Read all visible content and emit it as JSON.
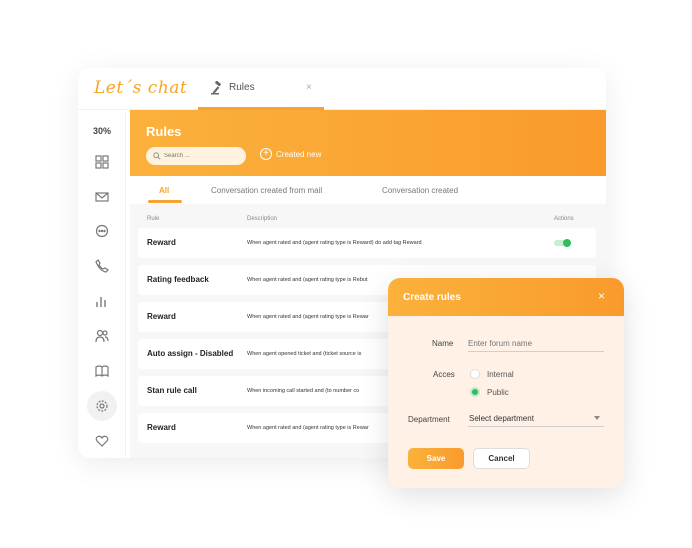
{
  "app": {
    "logo_text": "Let´s chat",
    "tab_label": "Rules",
    "tab_close": "×",
    "zoom_level": "30%"
  },
  "colors": {
    "accent": "#f7a233",
    "accent_light": "#fbb13c",
    "toggle_on": "#2ebd5f"
  },
  "sidebar": {
    "icons": [
      "dashboard-icon",
      "mail-icon",
      "chat-icon",
      "phone-icon",
      "stats-icon",
      "users-icon",
      "book-icon",
      "settings-icon",
      "heart-icon"
    ],
    "active": "settings-icon"
  },
  "header": {
    "title": "Rules",
    "search_placeholder": "Search ...",
    "create_new": "Created new"
  },
  "subtabs": [
    "All",
    "Conversation created from mail",
    "Conversation created"
  ],
  "table": {
    "columns": [
      "Rule",
      "Description",
      "Actions"
    ],
    "rows": [
      {
        "name": "Reward",
        "desc": "When agent rated and (agent rating type is Reward) do add tag Reward",
        "enabled": true
      },
      {
        "name": "Rating feedback",
        "desc": "When agent rated and (agent rating type is Rebut"
      },
      {
        "name": "Reward",
        "desc": "When agent rated and (agent rating type is Rewar"
      },
      {
        "name": "Auto assign - Disabled",
        "desc": "When agent opened ticket and (ticket source is"
      },
      {
        "name": "Stan rule call",
        "desc": "When incoming call started and (to number co"
      },
      {
        "name": "Reward",
        "desc": "When agent rated and (agent rating type is Rewar"
      }
    ]
  },
  "modal": {
    "title": "Create rules",
    "close": "×",
    "name_label": "Name",
    "name_placeholder": "Enter forum name",
    "access_label": "Acces",
    "access_options": [
      "Internal",
      "Public"
    ],
    "access_selected": "Public",
    "department_label": "Department",
    "department_value": "Select department",
    "save": "Save",
    "cancel": "Cancel"
  }
}
